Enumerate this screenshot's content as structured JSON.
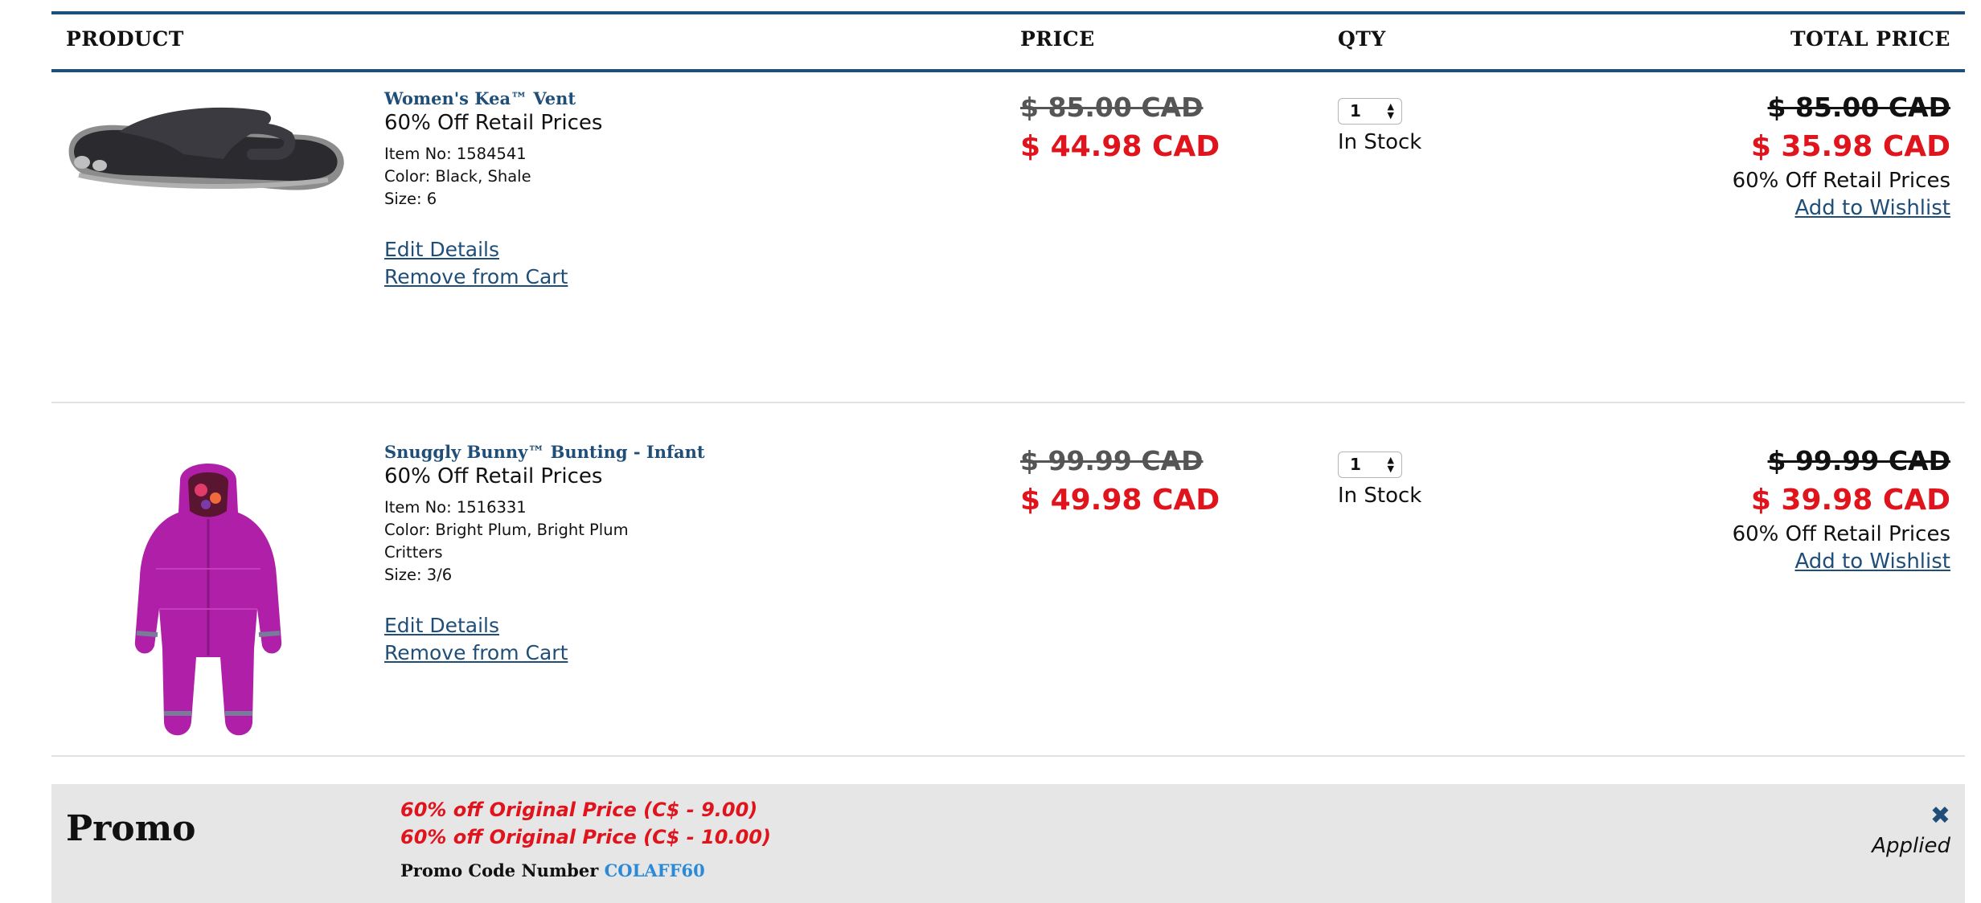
{
  "table_header": {
    "product": "PRODUCT",
    "price": "PRICE",
    "qty": "QTY",
    "total_price": "TOTAL PRICE"
  },
  "items": [
    {
      "name": "Women's Kea™ Vent",
      "promo_label": "60% Off Retail Prices",
      "item_no": "Item No: 1584541",
      "color_line1": "Color: Black, Shale",
      "color_line2": "",
      "size": "Size: 6",
      "edit_label": "Edit Details",
      "remove_label": "Remove from Cart",
      "price_original": "$ 85.00 CAD",
      "price_sale": "$ 44.98 CAD",
      "qty": "1",
      "stock": "In Stock",
      "total_original": "$ 85.00 CAD",
      "total_sale": "$ 35.98 CAD",
      "total_note": "60% Off Retail Prices",
      "wishlist_label": "Add to Wishlist",
      "image_icon": "sandal-product-image"
    },
    {
      "name": "Snuggly Bunny™ Bunting - Infant",
      "promo_label": "60% Off Retail Prices",
      "item_no": "Item No: 1516331",
      "color_line1": "Color: Bright Plum, Bright Plum",
      "color_line2": "Critters",
      "size": "Size: 3/6",
      "edit_label": "Edit Details",
      "remove_label": "Remove from Cart",
      "price_original": "$ 99.99 CAD",
      "price_sale": "$ 49.98 CAD",
      "qty": "1",
      "stock": "In Stock",
      "total_original": "$ 99.99 CAD",
      "total_sale": "$ 39.98 CAD",
      "total_note": "60% Off Retail Prices",
      "wishlist_label": "Add to Wishlist",
      "image_icon": "infant-bunting-product-image"
    }
  ],
  "promo": {
    "title": "Promo",
    "lines": [
      "60% off Original Price (C$ - 9.00)",
      "60% off Original Price (C$ - 10.00)"
    ],
    "code_label": "Promo Code Number",
    "code": "COLAFF60",
    "remove_icon": "close-icon",
    "status": "Applied"
  },
  "colors": {
    "accent_blue": "#1f4e79",
    "sale_red": "#e0141d",
    "promo_bg": "#e6e6e6",
    "code_blue": "#2a8ad8"
  }
}
